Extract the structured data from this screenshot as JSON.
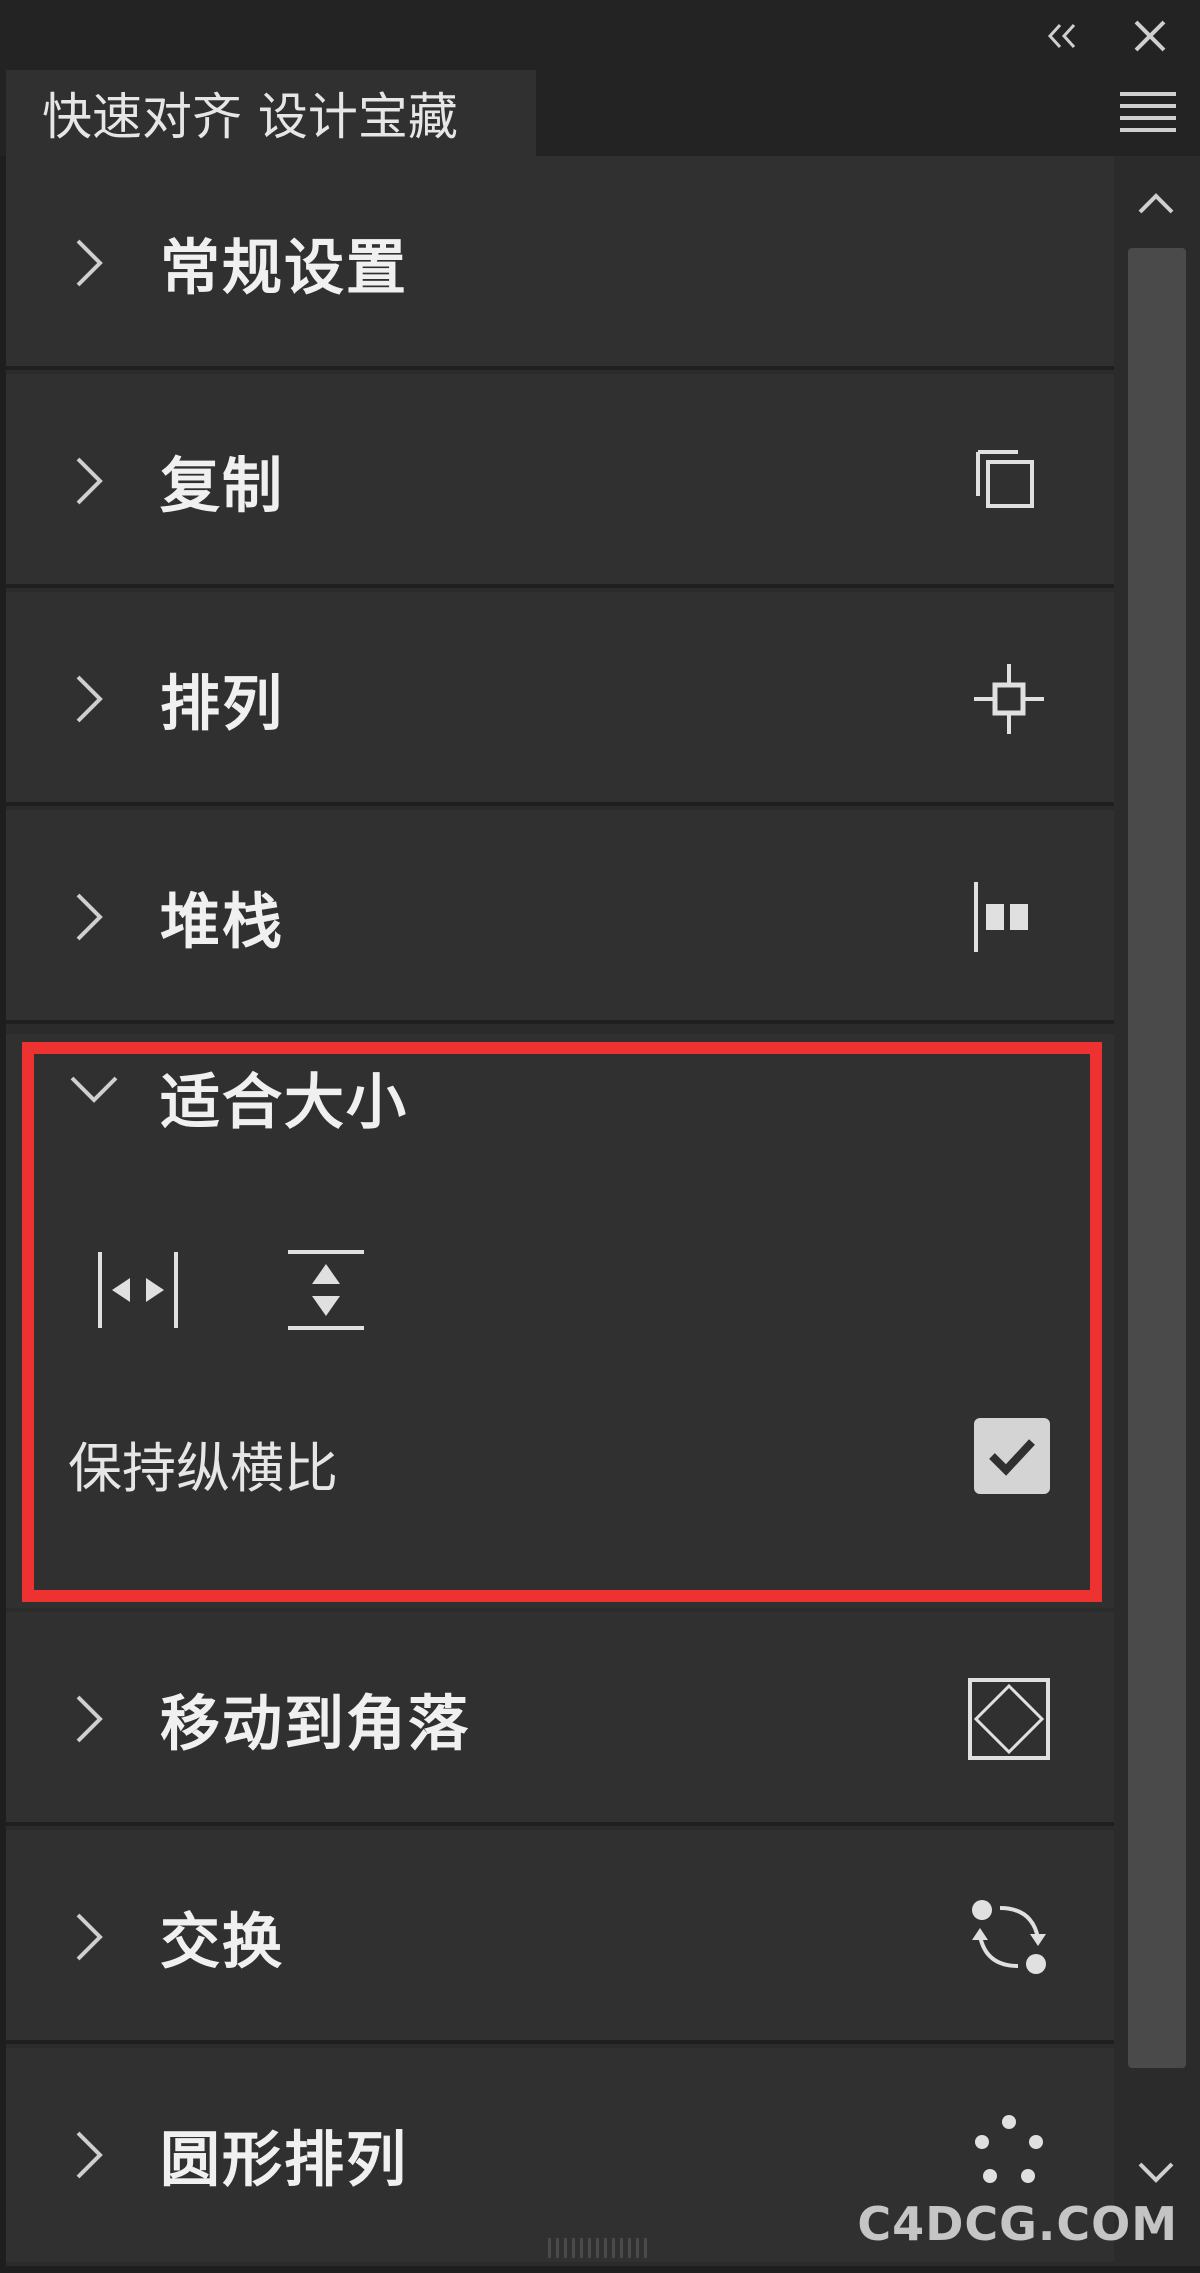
{
  "header": {
    "tab_title": "快速对齐 设计宝藏"
  },
  "sections": [
    {
      "label": "常规设置",
      "icon": "none"
    },
    {
      "label": "复制",
      "icon": "duplicate-icon"
    },
    {
      "label": "排列",
      "icon": "arrange-crosshair-icon"
    },
    {
      "label": "堆栈",
      "icon": "stack-icon"
    },
    {
      "label": "适合大小",
      "icon": "none",
      "expanded": true
    },
    {
      "label": "移动到角落",
      "icon": "move-to-corner-icon"
    },
    {
      "label": "交换",
      "icon": "swap-icon"
    },
    {
      "label": "圆形排列",
      "icon": "circle-arrange-icon"
    }
  ],
  "fit_size": {
    "keep_aspect_label": "保持纵横比",
    "keep_aspect_checked": true
  },
  "watermark": "C4DCG.COM",
  "colors": {
    "highlight_border": "#ee3232",
    "panel_bg": "#303030",
    "app_bg": "#1e1e1e"
  }
}
